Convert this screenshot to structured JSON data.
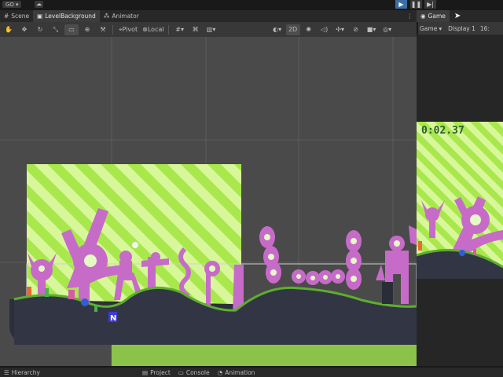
{
  "top": {
    "account": "GO",
    "play_icon": "play-icon",
    "pause_icon": "pause-icon",
    "step_icon": "step-icon"
  },
  "scene_tabs": [
    {
      "label": "Scene",
      "icon": "scene-icon"
    },
    {
      "label": "LevelBackground",
      "icon": "prefab-icon"
    },
    {
      "label": "Animator",
      "icon": "animator-icon"
    }
  ],
  "scene_toolbar": {
    "pivot": "Pivot",
    "local": "Local",
    "mode_2d": "2D"
  },
  "game_tab": {
    "label": "Game",
    "icon": "game-icon"
  },
  "game_toolbar": {
    "view": "Game",
    "display": "Display 1",
    "resolution": "16:"
  },
  "game": {
    "timer": "0:02.37"
  },
  "bottom_tabs": [
    {
      "label": "Hierarchy",
      "icon": "hierarchy-icon"
    },
    {
      "label": "Project",
      "icon": "project-icon"
    },
    {
      "label": "Console",
      "icon": "console-icon"
    },
    {
      "label": "Animation",
      "icon": "animation-icon"
    }
  ],
  "colors": {
    "sky_light": "#d8f79a",
    "sky_stripe": "#a8e84c",
    "ground": "#323644",
    "grass": "#5eae2e",
    "creature": "#c76bc9",
    "scene_bg": "#4a4a4a",
    "play_active": "#3a6ea5"
  }
}
